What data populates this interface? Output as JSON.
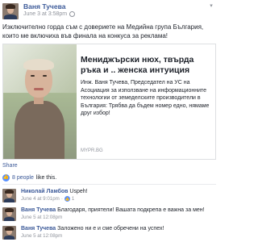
{
  "post": {
    "author": "Ваня Тучева",
    "timestamp": "June 3 at 3:58pm",
    "privacy_icon": "globe-icon",
    "text": "Изключително горда съм с довериете на Медийна група България, които ме включиха във финала на конкуса за реклама!",
    "link": {
      "title": "Мениджърски нюх, твърда ръка и .. женска интуиция",
      "description": "Инж. Ваня Тучева, Председател на УС на Асоциация за използване на информационните технологии от земеделските производители в България: Трябва да бъдем номер едно, нямаме друг избор!",
      "domain": "MYPR.BG"
    },
    "share_label": "Share",
    "likes": {
      "count_text": "8 people",
      "suffix": "like this."
    }
  },
  "comments": [
    {
      "author": "Николай Ламбов",
      "text": "Uspeh!",
      "timestamp": "June 4 at 9:01pm",
      "separator": "·",
      "likes": "1",
      "avatar": "dark"
    },
    {
      "author": "Ваня Тучева",
      "text": "Благодаря, приятели! Вашата подкрепа е важна за мен!",
      "timestamp": "June 5 at 12:08pm",
      "avatar": "dark"
    },
    {
      "author": "Ваня Тучева",
      "text": "Заложено ни е и сме обречени на успех!",
      "timestamp": "June 5 at 12:08pm",
      "avatar": "dark"
    }
  ]
}
